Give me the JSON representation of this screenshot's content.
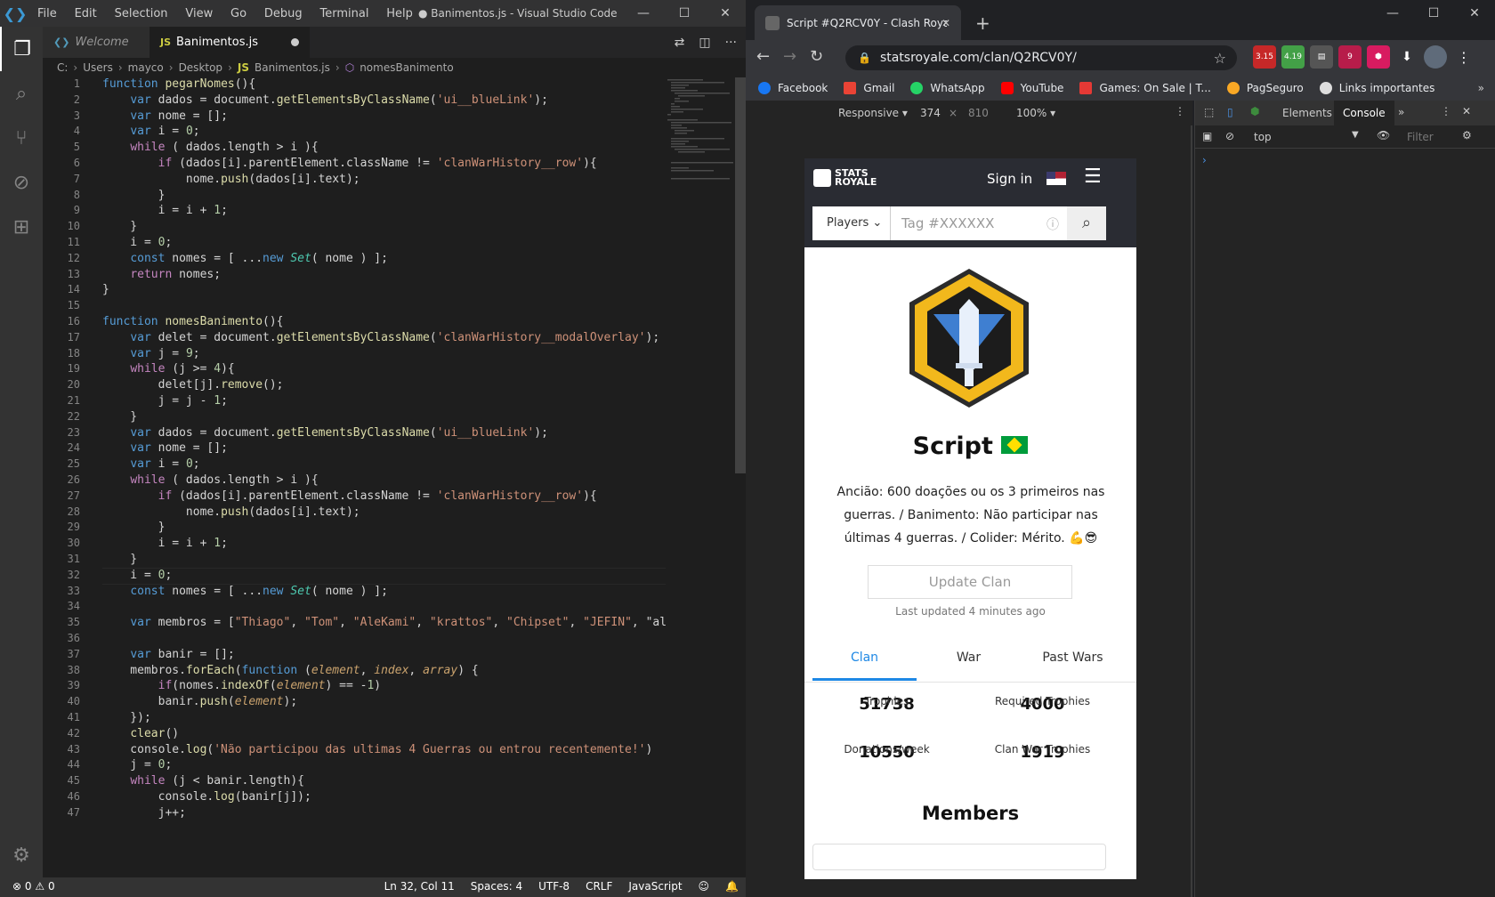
{
  "vscode": {
    "menu": [
      "File",
      "Edit",
      "Selection",
      "View",
      "Go",
      "Debug",
      "Terminal",
      "Help"
    ],
    "window_title": "● Banimentos.js - Visual Studio Code",
    "tabs": [
      {
        "label": "Welcome",
        "icon": "vscode-icon"
      },
      {
        "label": "Banimentos.js",
        "icon": "js-icon"
      }
    ],
    "breadcrumb": [
      "C:",
      "Users",
      "mayco",
      "Desktop",
      "JS",
      "Banimentos.js",
      "nomesBanimento"
    ],
    "status": {
      "errors": "0",
      "warnings": "0",
      "position": "Ln 32, Col 11",
      "spaces": "Spaces: 4",
      "encoding": "UTF-8",
      "eol": "CRLF",
      "language": "JavaScript"
    },
    "code_lines": [
      "function pegarNomes(){",
      "    var dados = document.getElementsByClassName('ui__blueLink');",
      "    var nome = [];",
      "    var i = 0;",
      "    while ( dados.length > i ){",
      "        if (dados[i].parentElement.className != 'clanWarHistory__row'){",
      "            nome.push(dados[i].text);",
      "        }",
      "        i = i + 1;",
      "    }",
      "    i = 0;",
      "    const nomes = [ ...new Set( nome ) ];",
      "    return nomes;",
      "}",
      "",
      "function nomesBanimento(){",
      "    var delet = document.getElementsByClassName('clanWarHistory__modalOverlay');",
      "    var j = 9;",
      "    while (j >= 4){",
      "        delet[j].remove();",
      "        j = j - 1;",
      "    }",
      "    var dados = document.getElementsByClassName('ui__blueLink');",
      "    var nome = [];",
      "    var i = 0;",
      "    while ( dados.length > i ){",
      "        if (dados[i].parentElement.className != 'clanWarHistory__row'){",
      "            nome.push(dados[i].text);",
      "        }",
      "        i = i + 1;",
      "    }",
      "    i = 0;",
      "    const nomes = [ ...new Set( nome ) ];",
      "",
      "    var membros = [\"Thiago\", \"Tom\", \"AleKami\", \"krattos\", \"Chipset\", \"JEFIN\", \"ald",
      "",
      "    var banir = [];",
      "    membros.forEach(function (element, index, array) {",
      "        if(nomes.indexOf(element) == -1)",
      "        banir.push(element);",
      "    });",
      "    clear()",
      "    console.log('Não participou das ultimas 4 Guerras ou entrou recentemente!')",
      "    j = 0;",
      "    while (j < banir.length){",
      "        console.log(banir[j]);",
      "        j++;"
    ]
  },
  "chrome": {
    "tab_title": "Script #Q2RCV0Y - Clash Royale",
    "url": "statsroyale.com/clan/Q2RCV0Y/",
    "extensions": [
      "3.15",
      "4.19",
      "",
      "9",
      "",
      ""
    ],
    "bookmarks": [
      "Facebook",
      "Gmail",
      "WhatsApp",
      "YouTube",
      "Games: On Sale | T...",
      "PagSeguro",
      "Links importantes"
    ],
    "device": {
      "mode": "Responsive",
      "width": "374",
      "height": "810",
      "zoom": "100%"
    },
    "devtools": {
      "tabs": [
        "Elements",
        "Console"
      ],
      "context": "top",
      "filter": "Filter"
    }
  },
  "site": {
    "logo": "STATS ROYALE",
    "signin": "Sign in",
    "search_select": "Players",
    "search_placeholder": "Tag #XXXXXX",
    "clan_name": "Script",
    "description": "Ancião: 600 doações ou os 3 primeiros nas guerras. / Banimento: Não participar nas últimas 4 guerras. / Colider: Mérito. 💪😎",
    "update_button": "Update Clan",
    "last_updated": "Last updated 4 minutes ago",
    "tabs": [
      "Clan",
      "War",
      "Past Wars"
    ],
    "stats": [
      {
        "value": "51738",
        "label": "Trophies"
      },
      {
        "value": "4000",
        "label": "Required Trophies"
      },
      {
        "value": "10550",
        "label": "Donations/week"
      },
      {
        "value": "1919",
        "label": "Clan War Trophies"
      }
    ],
    "members_title": "Members"
  }
}
